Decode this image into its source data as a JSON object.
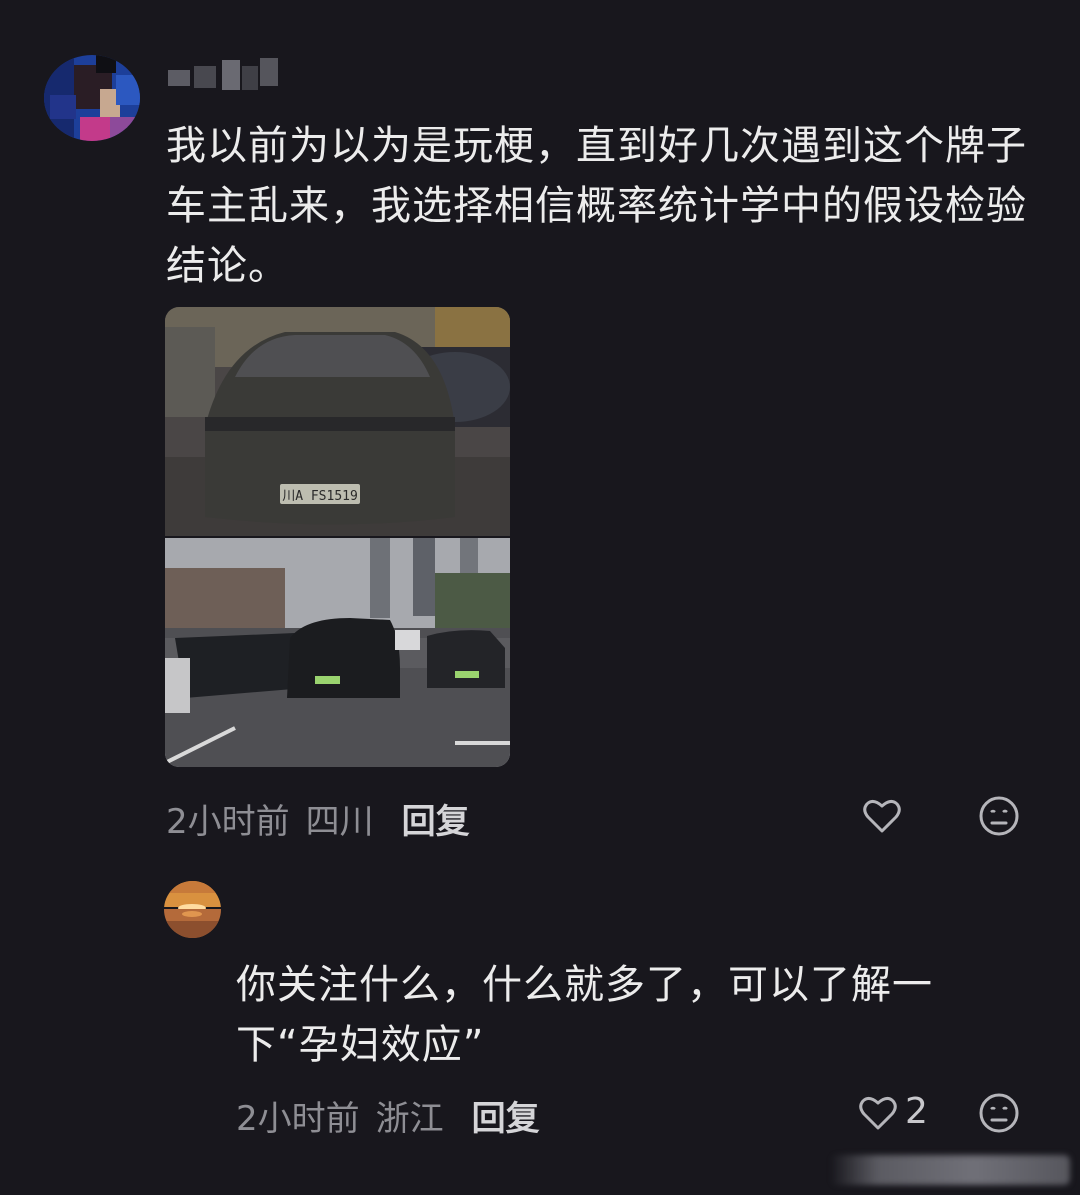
{
  "comments": [
    {
      "username": "",
      "text": "我以前为以为是玩梗，直到好几次遇到这个牌子车主乱来，我选择相信概率统计学中的假设检验结论。",
      "time": "2小时前",
      "location": "四川",
      "reply_label": "回复",
      "like_count": "",
      "photos": {
        "top_plate": "川A FS1519"
      }
    },
    {
      "username": "",
      "text": "你关注什么，什么就多了，可以了解一下“孕妇效应”",
      "time": "2小时前",
      "location": "浙江",
      "reply_label": "回复",
      "like_count": "2"
    }
  ],
  "icons": {
    "like": "heart-icon",
    "dislike": "meh-face-icon"
  },
  "colors": {
    "background": "#18171d",
    "meta_text": "#8e8e94",
    "reply_text": "#d5d5d8"
  }
}
